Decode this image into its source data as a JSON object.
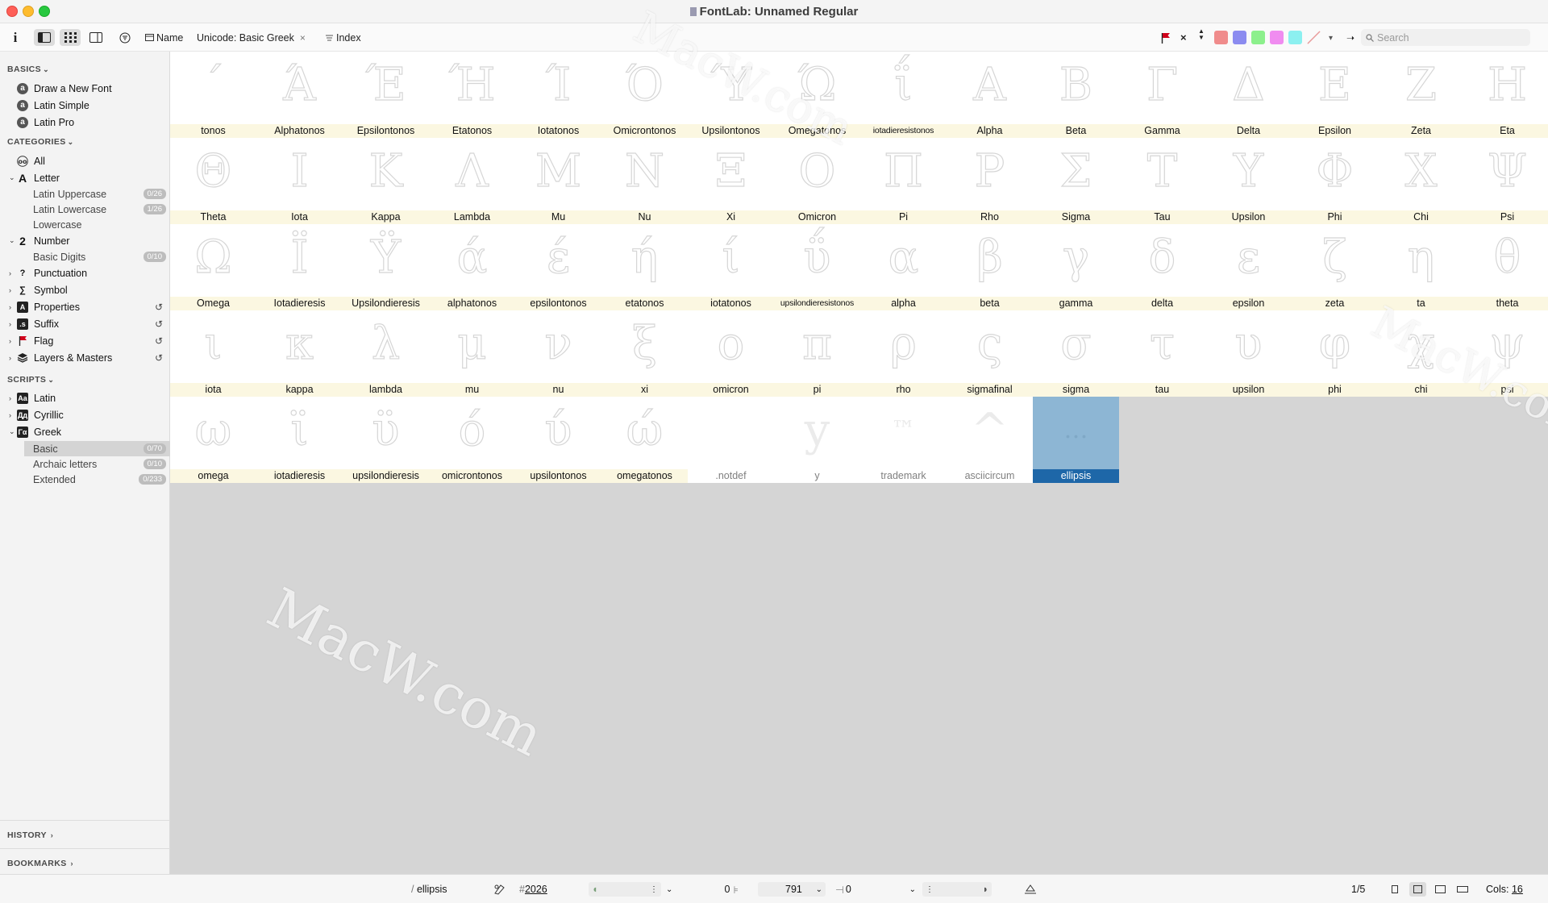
{
  "window": {
    "title": "FontLab: Unnamed Regular",
    "close_glyph": "×"
  },
  "toolbar": {
    "info_icon": "i",
    "name_label": "Name",
    "unicode_label": "Unicode: Basic Greek",
    "unicode_clear": "×",
    "index_label": "Index",
    "clear_flag_glyph": "×",
    "search_placeholder": "Search",
    "swatch_colors": [
      "#f08c8c",
      "#8c8cf0",
      "#8cf08c",
      "#f08cf0",
      "#8cf0f0"
    ]
  },
  "sidebar": {
    "basics": {
      "header": "BASICS",
      "items": [
        {
          "label": "Draw a New Font",
          "icon": "a"
        },
        {
          "label": "Latin Simple",
          "icon": "a"
        },
        {
          "label": "Latin Pro",
          "icon": "a"
        }
      ]
    },
    "categories": {
      "header": "CATEGORIES",
      "all": "All",
      "letter": "Letter",
      "letter_sub": [
        {
          "label": "Latin Uppercase",
          "count": "0/26"
        },
        {
          "label": "Latin Lowercase",
          "count": "1/26"
        },
        {
          "label": "Lowercase",
          "count": ""
        }
      ],
      "number": "Number",
      "number_sub": [
        {
          "label": "Basic Digits",
          "count": "0/10"
        }
      ],
      "punctuation": "Punctuation",
      "symbol": "Symbol",
      "properties": "Properties",
      "suffix": "Suffix",
      "flag": "Flag",
      "layers": "Layers & Masters"
    },
    "scripts": {
      "header": "SCRIPTS",
      "latin": "Latin",
      "cyrillic": "Cyrillic",
      "greek": "Greek",
      "greek_sub": [
        {
          "label": "Basic",
          "count": "0/70"
        },
        {
          "label": "Archaic letters",
          "count": "0/10"
        },
        {
          "label": "Extended",
          "count": "0/233"
        }
      ]
    },
    "history": "HISTORY",
    "bookmarks": "BOOKMARKS"
  },
  "glyphs": [
    {
      "name": "tonos",
      "char": "΄"
    },
    {
      "name": "Alphatonos",
      "char": "Ά"
    },
    {
      "name": "Epsilontonos",
      "char": "Έ"
    },
    {
      "name": "Etatonos",
      "char": "Ή"
    },
    {
      "name": "Iotatonos",
      "char": "Ί"
    },
    {
      "name": "Omicrontonos",
      "char": "Ό"
    },
    {
      "name": "Upsilontonos",
      "char": "Ύ"
    },
    {
      "name": "Omegatonos",
      "char": "Ώ"
    },
    {
      "name": "iotadieresistonos",
      "char": "ΐ"
    },
    {
      "name": "Alpha",
      "char": "Α"
    },
    {
      "name": "Beta",
      "char": "Β"
    },
    {
      "name": "Gamma",
      "char": "Γ"
    },
    {
      "name": "Delta",
      "char": "Δ"
    },
    {
      "name": "Epsilon",
      "char": "Ε"
    },
    {
      "name": "Zeta",
      "char": "Ζ"
    },
    {
      "name": "Eta",
      "char": "Η"
    },
    {
      "name": "Theta",
      "char": "Θ"
    },
    {
      "name": "Iota",
      "char": "Ι"
    },
    {
      "name": "Kappa",
      "char": "Κ"
    },
    {
      "name": "Lambda",
      "char": "Λ"
    },
    {
      "name": "Mu",
      "char": "Μ"
    },
    {
      "name": "Nu",
      "char": "Ν"
    },
    {
      "name": "Xi",
      "char": "Ξ"
    },
    {
      "name": "Omicron",
      "char": "Ο"
    },
    {
      "name": "Pi",
      "char": "Π"
    },
    {
      "name": "Rho",
      "char": "Ρ"
    },
    {
      "name": "Sigma",
      "char": "Σ"
    },
    {
      "name": "Tau",
      "char": "Τ"
    },
    {
      "name": "Upsilon",
      "char": "Υ"
    },
    {
      "name": "Phi",
      "char": "Φ"
    },
    {
      "name": "Chi",
      "char": "Χ"
    },
    {
      "name": "Psi",
      "char": "Ψ"
    },
    {
      "name": "Omega",
      "char": "Ω"
    },
    {
      "name": "Iotadieresis",
      "char": "Ϊ"
    },
    {
      "name": "Upsilondieresis",
      "char": "Ϋ"
    },
    {
      "name": "alphatonos",
      "char": "ά"
    },
    {
      "name": "epsilontonos",
      "char": "έ"
    },
    {
      "name": "etatonos",
      "char": "ή"
    },
    {
      "name": "iotatonos",
      "char": "ί"
    },
    {
      "name": "upsilondieresistonos",
      "char": "ΰ"
    },
    {
      "name": "alpha",
      "char": "α"
    },
    {
      "name": "beta",
      "char": "β"
    },
    {
      "name": "gamma",
      "char": "γ"
    },
    {
      "name": "delta",
      "char": "δ"
    },
    {
      "name": "epsilon",
      "char": "ε"
    },
    {
      "name": "zeta",
      "char": "ζ"
    },
    {
      "name": "ta",
      "char": "η"
    },
    {
      "name": "theta",
      "char": "θ"
    },
    {
      "name": "iota",
      "char": "ι"
    },
    {
      "name": "kappa",
      "char": "κ"
    },
    {
      "name": "lambda",
      "char": "λ"
    },
    {
      "name": "mu",
      "char": "μ"
    },
    {
      "name": "nu",
      "char": "ν"
    },
    {
      "name": "xi",
      "char": "ξ"
    },
    {
      "name": "omicron",
      "char": "ο"
    },
    {
      "name": "pi",
      "char": "π"
    },
    {
      "name": "rho",
      "char": "ρ"
    },
    {
      "name": "sigmafinal",
      "char": "ς"
    },
    {
      "name": "sigma",
      "char": "σ"
    },
    {
      "name": "tau",
      "char": "τ"
    },
    {
      "name": "upsilon",
      "char": "υ"
    },
    {
      "name": "phi",
      "char": "φ"
    },
    {
      "name": "chi",
      "char": "χ"
    },
    {
      "name": "psi",
      "char": "ψ"
    },
    {
      "name": "omega",
      "char": "ω"
    },
    {
      "name": "iotadieresis",
      "char": "ϊ"
    },
    {
      "name": "upsilondieresis",
      "char": "ϋ"
    },
    {
      "name": "omicrontonos",
      "char": "ό"
    },
    {
      "name": "upsilontonos",
      "char": "ύ"
    },
    {
      "name": "omegatonos",
      "char": "ώ"
    },
    {
      "name": ".notdef",
      "char": "",
      "generic": true
    },
    {
      "name": "y",
      "char": "y",
      "generic": true
    },
    {
      "name": "trademark",
      "char": "™",
      "generic": true
    },
    {
      "name": "asciicircum",
      "char": "^",
      "generic": true
    },
    {
      "name": "ellipsis",
      "char": "…",
      "selected": true
    }
  ],
  "watermarks": [
    "MacW.com",
    "MacW.com",
    "MacW.com"
  ],
  "statusbar": {
    "glyph_name": "ellipsis",
    "unicode": "2026",
    "lsb": "0",
    "advance": "791",
    "rsb": "0",
    "page": "1/5",
    "cols_label": "Cols:",
    "cols_value": "16"
  }
}
